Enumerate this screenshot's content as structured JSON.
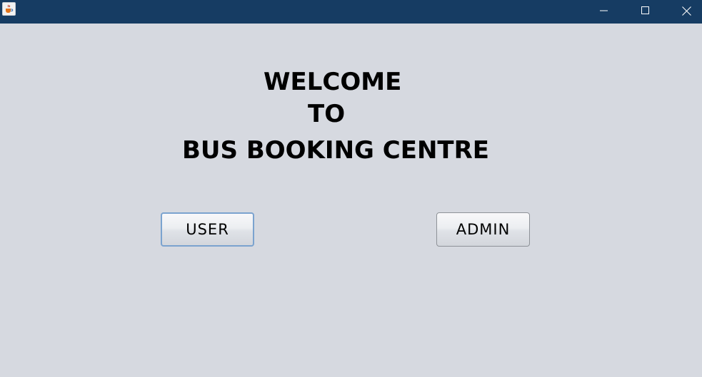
{
  "window": {
    "controls": {
      "minimize_icon": "minimize-icon",
      "maximize_icon": "maximize-icon",
      "close_icon": "close-icon"
    },
    "colors": {
      "titlebar": "#163c63",
      "background": "#d6d9e0",
      "focus_border": "#7ba3cf"
    }
  },
  "welcome": {
    "line1": "WELCOME",
    "line2": "TO",
    "line3": "BUS BOOKING CENTRE"
  },
  "buttons": {
    "user_label": "USER",
    "admin_label": "ADMIN"
  }
}
